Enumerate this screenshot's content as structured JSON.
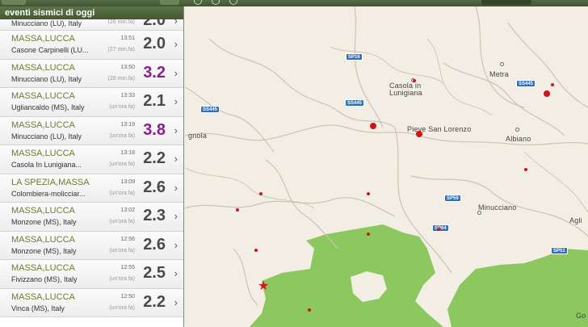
{
  "sidebar": {
    "header": "eventi sismici di oggi",
    "events": [
      {
        "location": "",
        "place": "Minucciano (LU), Italy",
        "time": "",
        "ago": "(26 min.fa)",
        "magnitude": "2.0",
        "high": false,
        "partial": true
      },
      {
        "location": "MASSA,LUCCA",
        "place": "Casone Carpinelli (LU...",
        "time": "13:51",
        "ago": "(27 min.fa)",
        "magnitude": "2.0",
        "high": false
      },
      {
        "location": "MASSA,LUCCA",
        "place": "Minucciano (LU), Italy",
        "time": "13:50",
        "ago": "(28 min.fa)",
        "magnitude": "3.2",
        "high": true
      },
      {
        "location": "MASSA,LUCCA",
        "place": "Ugliancaldo (MS), Italy",
        "time": "13:33",
        "ago": "(un'ora fa)",
        "magnitude": "2.1",
        "high": false
      },
      {
        "location": "MASSA,LUCCA",
        "place": "Minucciano (LU), Italy",
        "time": "13:19",
        "ago": "(un'ora fa)",
        "magnitude": "3.8",
        "high": true
      },
      {
        "location": "MASSA,LUCCA",
        "place": "Casola In Lunigiana...",
        "time": "13:18",
        "ago": "(un'ora fa)",
        "magnitude": "2.2",
        "high": false
      },
      {
        "location": "LA SPEZIA,MASSA",
        "place": "Colombiera-molicciar...",
        "time": "13:09",
        "ago": "(un'ora fa)",
        "magnitude": "2.6",
        "high": false
      },
      {
        "location": "MASSA,LUCCA",
        "place": "Monzone (MS), Italy",
        "time": "13:02",
        "ago": "(un'ora fa)",
        "magnitude": "2.3",
        "high": false
      },
      {
        "location": "MASSA,LUCCA",
        "place": "Monzone (MS), Italy",
        "time": "12:56",
        "ago": "(un'ora fa)",
        "magnitude": "2.6",
        "high": false
      },
      {
        "location": "MASSA,LUCCA",
        "place": "Fivizzano (MS), Italy",
        "time": "12:55",
        "ago": "(un'ora fa)",
        "magnitude": "2.5",
        "high": false
      },
      {
        "location": "MASSA,LUCCA",
        "place": "Vinca (MS), Italy",
        "time": "12:50",
        "ago": "(un'ora fa)",
        "magnitude": "2.2",
        "high": false
      }
    ]
  },
  "map": {
    "road_labels": [
      "SP16",
      "SS445",
      "SS445",
      "SS445",
      "SP59",
      "SP64",
      "SP51"
    ],
    "places": [
      "Casola in\nLunigiana",
      "Pieve San Lorenzo",
      "Metra",
      "Albiano",
      "Minucciano",
      "Agli",
      "gnola",
      "Go"
    ],
    "colors": {
      "quake": "#d5121a",
      "park": "#8cc85f",
      "road_shield": "#2f6fb8"
    }
  }
}
